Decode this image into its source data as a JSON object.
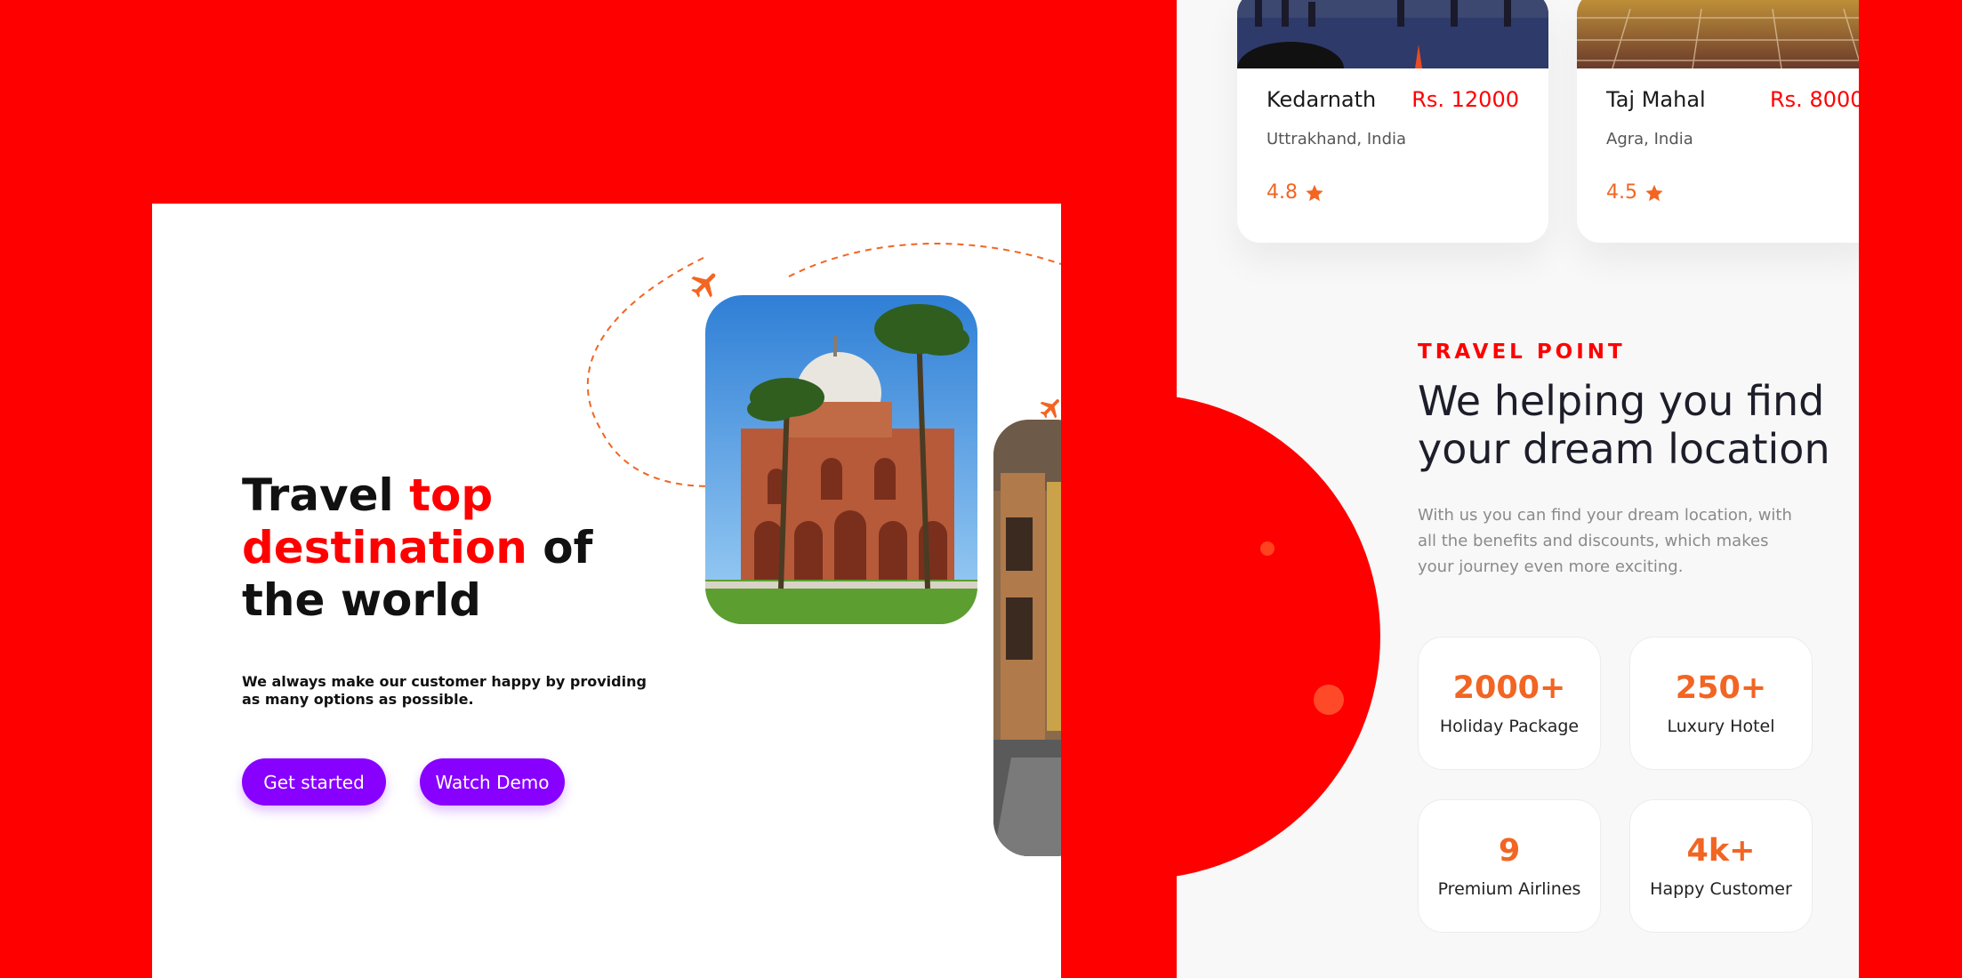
{
  "hero": {
    "title_part1": "Travel ",
    "title_accent": "top destination",
    "title_part2": " of the world",
    "subtitle": "We always make our customer happy by providing as many options as possible.",
    "primary_button": "Get started",
    "secondary_button": "Watch Demo"
  },
  "destinations": [
    {
      "name": "Kedarnath",
      "price": "Rs. 12000",
      "location": "Uttrakhand, India",
      "rating": "4.8"
    },
    {
      "name": "Taj Mahal",
      "price": "Rs. 8000",
      "location": "Agra, India",
      "rating": "4.5"
    }
  ],
  "about": {
    "eyebrow": "TRAVEL POINT",
    "title": "We helping you find your dream location",
    "description": "With us you can find your dream location, with all the benefits and discounts, which makes your journey even more exciting."
  },
  "stats": [
    {
      "value": "2000+",
      "label": "Holiday Package"
    },
    {
      "value": "250+",
      "label": "Luxury Hotel"
    },
    {
      "value": "9",
      "label": "Premium Airlines"
    },
    {
      "value": "4k+",
      "label": "Happy Customer"
    }
  ],
  "colors": {
    "background": "#ff0000",
    "accent": "#ff0000",
    "button": "#8800ff",
    "stat": "#f26522"
  },
  "icons": [
    "airplane-icon",
    "star-icon"
  ]
}
